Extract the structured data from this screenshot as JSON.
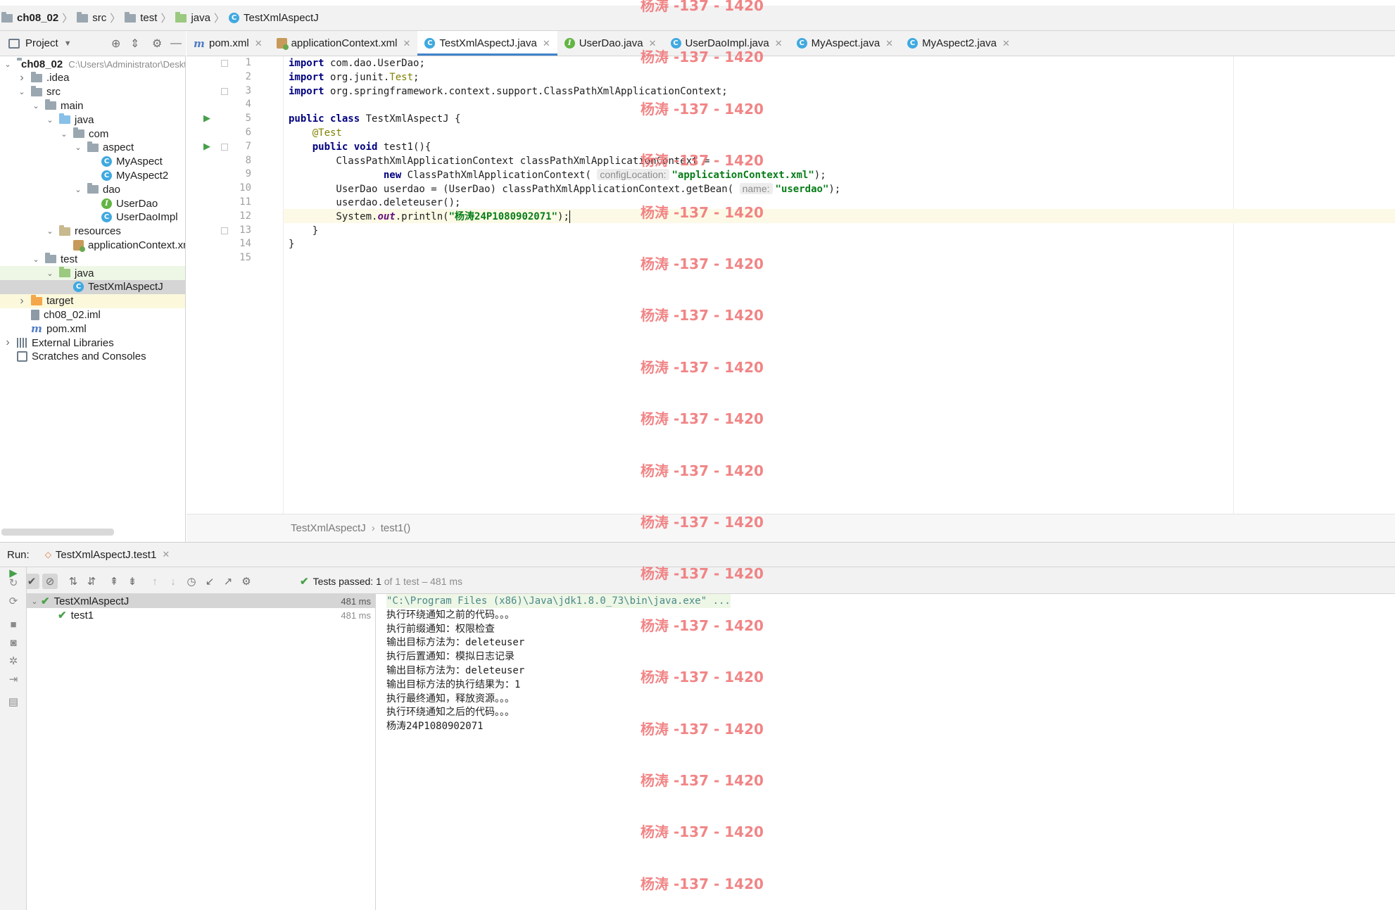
{
  "breadcrumb": [
    "ch08_02",
    "src",
    "test",
    "java",
    "TestXmlAspectJ"
  ],
  "project_panel": {
    "title": "Project",
    "tree": [
      {
        "label": "ch08_02",
        "path": "C:\\Users\\Administrator\\Deskt",
        "depth": 0,
        "expanded": true,
        "icon": "module-folder-icon"
      },
      {
        "label": ".idea",
        "depth": 1,
        "expanded": false,
        "icon": "folder-icon"
      },
      {
        "label": "src",
        "depth": 1,
        "expanded": true,
        "icon": "folder-icon"
      },
      {
        "label": "main",
        "depth": 2,
        "expanded": true,
        "icon": "folder-icon"
      },
      {
        "label": "java",
        "depth": 3,
        "expanded": true,
        "icon": "source-folder-icon"
      },
      {
        "label": "com",
        "depth": 4,
        "expanded": true,
        "icon": "package-icon"
      },
      {
        "label": "aspect",
        "depth": 5,
        "expanded": true,
        "icon": "package-icon"
      },
      {
        "label": "MyAspect",
        "depth": 6,
        "icon": "class-icon"
      },
      {
        "label": "MyAspect2",
        "depth": 6,
        "icon": "class-icon"
      },
      {
        "label": "dao",
        "depth": 5,
        "expanded": true,
        "icon": "package-icon"
      },
      {
        "label": "UserDao",
        "depth": 6,
        "icon": "interface-icon"
      },
      {
        "label": "UserDaoImpl",
        "depth": 6,
        "icon": "class-icon"
      },
      {
        "label": "resources",
        "depth": 3,
        "expanded": true,
        "icon": "resources-folder-icon"
      },
      {
        "label": "applicationContext.xml",
        "depth": 4,
        "icon": "xml-file-icon"
      },
      {
        "label": "test",
        "depth": 2,
        "expanded": true,
        "icon": "folder-icon"
      },
      {
        "label": "java",
        "depth": 3,
        "expanded": true,
        "icon": "test-folder-icon"
      },
      {
        "label": "TestXmlAspectJ",
        "depth": 4,
        "icon": "test-class-icon",
        "selected": true
      },
      {
        "label": "target",
        "depth": 1,
        "expanded": false,
        "icon": "excluded-folder-icon"
      },
      {
        "label": "ch08_02.iml",
        "depth": 1,
        "icon": "iml-file-icon"
      },
      {
        "label": "pom.xml",
        "depth": 1,
        "icon": "maven-icon"
      },
      {
        "label": "External Libraries",
        "depth": 0,
        "expanded": false,
        "icon": "library-icon"
      },
      {
        "label": "Scratches and Consoles",
        "depth": 0,
        "icon": "scratches-icon"
      }
    ]
  },
  "tabs": [
    {
      "label": "pom.xml",
      "icon": "maven-icon"
    },
    {
      "label": "applicationContext.xml",
      "icon": "xml-file-icon"
    },
    {
      "label": "TestXmlAspectJ.java",
      "icon": "test-class-icon",
      "active": true
    },
    {
      "label": "UserDao.java",
      "icon": "interface-icon"
    },
    {
      "label": "UserDaoImpl.java",
      "icon": "class-icon"
    },
    {
      "label": "MyAspect.java",
      "icon": "class-icon"
    },
    {
      "label": "MyAspect2.java",
      "icon": "class-icon"
    }
  ],
  "editor": {
    "current_line": 12,
    "lines": [
      {
        "n": "1",
        "tokens": [
          {
            "t": "import",
            "c": "kw"
          },
          {
            "t": " com.dao.UserDao;"
          }
        ]
      },
      {
        "n": "2",
        "tokens": [
          {
            "t": "import",
            "c": "kw"
          },
          {
            "t": " org.junit."
          },
          {
            "t": "Test",
            "c": "ann"
          },
          {
            "t": ";"
          }
        ]
      },
      {
        "n": "3",
        "tokens": [
          {
            "t": "import",
            "c": "kw"
          },
          {
            "t": " org.springframework.context.support.ClassPathXmlApplicationContext;"
          }
        ]
      },
      {
        "n": "4",
        "tokens": []
      },
      {
        "n": "5",
        "tokens": [
          {
            "t": "public class",
            "c": "kw"
          },
          {
            "t": " TestXmlAspectJ {"
          }
        ]
      },
      {
        "n": "6",
        "tokens": [
          {
            "t": "    "
          },
          {
            "t": "@Test",
            "c": "ann"
          }
        ]
      },
      {
        "n": "7",
        "tokens": [
          {
            "t": "    "
          },
          {
            "t": "public void",
            "c": "kw"
          },
          {
            "t": " test1(){"
          }
        ]
      },
      {
        "n": "8",
        "tokens": [
          {
            "t": "        ClassPathXmlApplicationContext classPathXmlApplicationContext ="
          }
        ]
      },
      {
        "n": "9",
        "tokens": [
          {
            "t": "                "
          },
          {
            "t": "new",
            "c": "kw"
          },
          {
            "t": " ClassPathXmlApplicationContext( "
          },
          {
            "t": "configLocation:",
            "c": "hint"
          },
          {
            "t": "\"applicationContext.xml\"",
            "c": "str"
          },
          {
            "t": ");"
          }
        ]
      },
      {
        "n": "10",
        "tokens": [
          {
            "t": "        UserDao userdao = (UserDao) classPathXmlApplicationContext.getBean( "
          },
          {
            "t": "name:",
            "c": "hint"
          },
          {
            "t": "\"userdao\"",
            "c": "str"
          },
          {
            "t": ");"
          }
        ]
      },
      {
        "n": "11",
        "tokens": [
          {
            "t": "        userdao.deleteuser();"
          }
        ]
      },
      {
        "n": "12",
        "tokens": [
          {
            "t": "        System."
          },
          {
            "t": "out",
            "c": "fld"
          },
          {
            "t": ".println("
          },
          {
            "t": "\"杨涛24P1080902071\"",
            "c": "str"
          },
          {
            "t": ");"
          }
        ]
      },
      {
        "n": "13",
        "tokens": [
          {
            "t": "    }"
          }
        ]
      },
      {
        "n": "14",
        "tokens": [
          {
            "t": "}"
          }
        ]
      },
      {
        "n": "15",
        "tokens": []
      }
    ]
  },
  "editor_breadcrumb": [
    "TestXmlAspectJ",
    "test1()"
  ],
  "run_panel": {
    "label": "Run:",
    "config_tab": "TestXmlAspectJ.test1",
    "status_prefix": "Tests passed:",
    "status_count": "1",
    "status_suffix": "of 1 test – 481 ms",
    "tests": [
      {
        "name": "TestXmlAspectJ",
        "time": "481 ms",
        "depth": 0,
        "passed": true
      },
      {
        "name": "test1",
        "time": "481 ms",
        "depth": 1,
        "passed": true
      }
    ],
    "console": [
      "\"C:\\Program Files (x86)\\Java\\jdk1.8.0_73\\bin\\java.exe\" ...",
      "执行环绕通知之前的代码。。。",
      "执行前缀通知：权限检查",
      "输出目标方法为：deleteuser",
      "执行后置通知：模拟日志记录",
      "输出目标方法为：deleteuser",
      "输出目标方法的执行结果为：1",
      "执行最终通知，释放资源。。。",
      "执行环绕通知之后的代码。。。",
      "杨涛24P1080902071"
    ]
  },
  "watermark_text": "杨涛 -137 - 1420",
  "colors": {
    "keyword": "#000080",
    "string": "#067d17",
    "annotation": "#808000",
    "watermark": "#f0787a",
    "pass_green": "#4aa24a",
    "tab_underline": "#4083c9"
  }
}
